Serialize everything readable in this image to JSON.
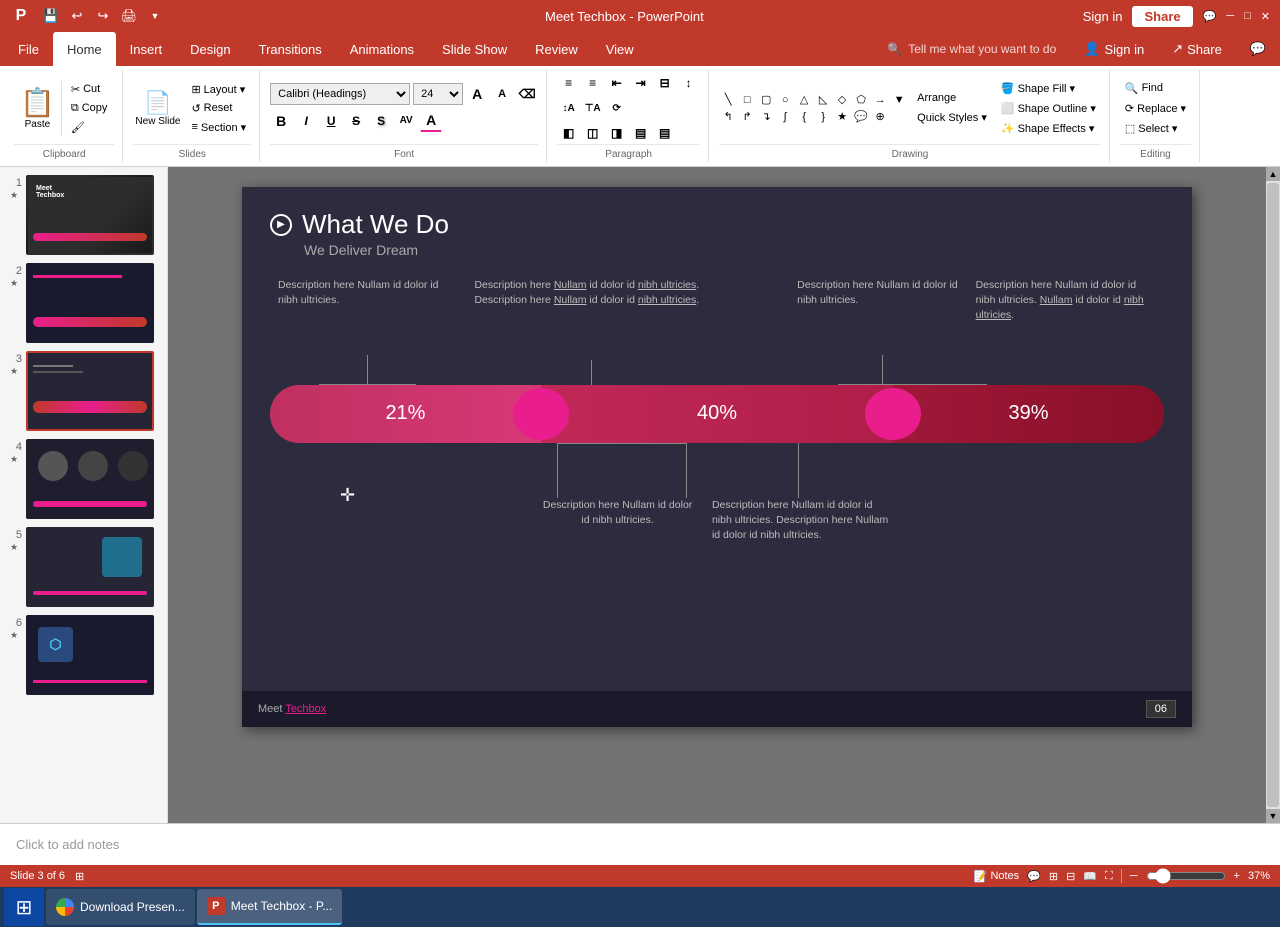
{
  "app": {
    "title": "Meet Techbox - PowerPoint",
    "sign_in": "Sign in",
    "share": "Share"
  },
  "titlebar": {
    "buttons": [
      "─",
      "□",
      "✕"
    ],
    "quickaccess": [
      "💾",
      "↩",
      "↪",
      "🖨",
      "▼"
    ]
  },
  "ribbon": {
    "tabs": [
      "File",
      "Home",
      "Insert",
      "Design",
      "Transitions",
      "Animations",
      "Slide Show",
      "Review",
      "View"
    ],
    "active_tab": "Home",
    "tell_me": "Tell me what you want to do",
    "groups": {
      "clipboard": {
        "label": "Clipboard",
        "paste": "Paste",
        "cut": "Cut",
        "copy": "Copy",
        "format_painter": "Format Painter"
      },
      "slides": {
        "label": "Slides",
        "new_slide": "New Slide",
        "layout": "Layout",
        "reset": "Reset",
        "section": "Section"
      },
      "font": {
        "label": "Font",
        "font_name": "Calibri (Headings)",
        "font_size": "24",
        "grow": "A",
        "shrink": "A",
        "clear": "Clear Formatting",
        "bold": "B",
        "italic": "I",
        "underline": "U",
        "strikethrough": "S",
        "shadow": "S",
        "char_spacing": "AV",
        "color": "A"
      },
      "paragraph": {
        "label": "Paragraph",
        "bullets": "≡",
        "numbering": "≡",
        "decrease_indent": "⇤",
        "increase_indent": "⇥",
        "text_direction": "Text Direction",
        "align_text": "Align Text",
        "smartart": "Convert to SmartArt"
      },
      "drawing": {
        "label": "Drawing",
        "shapes": "Shapes",
        "arrange": "Arrange",
        "quick_styles": "Quick Styles",
        "shape_fill": "Shape Fill",
        "shape_outline": "Shape Outline",
        "shape_effects": "Shape Effects"
      },
      "editing": {
        "label": "Editing",
        "find": "Find",
        "replace": "Replace",
        "select": "Select"
      }
    }
  },
  "slide_panel": {
    "slides": [
      {
        "num": "1",
        "label": "Slide 1",
        "has_star": true
      },
      {
        "num": "2",
        "label": "Slide 2",
        "has_star": true
      },
      {
        "num": "3",
        "label": "Slide 3",
        "has_star": true,
        "active": true
      },
      {
        "num": "4",
        "label": "Slide 4",
        "has_star": true
      },
      {
        "num": "5",
        "label": "Slide 5",
        "has_star": true
      },
      {
        "num": "6",
        "label": "Slide 6",
        "has_star": true
      }
    ]
  },
  "slide": {
    "title": "What We Do",
    "play_icon": "▶",
    "subtitle": "We Deliver Dream",
    "chart": {
      "segments": [
        {
          "label": "21%",
          "flex": 1
        },
        {
          "label": "40%",
          "flex": 1.4
        },
        {
          "label": "39%",
          "flex": 1
        }
      ],
      "top_descriptions": [
        {
          "text": "Description here Nullam id dolor id nibh ultricies.",
          "col": 1
        },
        {
          "text": "Description here Nullam id dolor id nibh ultricies. Description here Nullam id dolor id nibh ultricies.",
          "col": 2
        },
        {
          "text": "",
          "col": 3
        },
        {
          "text": "Description here Nullam id dolor id nibh ultricies.",
          "col": 4
        },
        {
          "text": "Description here Nullam id dolor id nibh ultricies. Nullam id dolor id nibh ultricies.",
          "col": 5
        }
      ],
      "bottom_descriptions": [
        {
          "text": "Description here Nullam id dolor id nibh ultricies.",
          "col": 1
        },
        {
          "text": "Description here Nullam id dolor id nibh ultricies. Description here Nullam id dolor id nibh ultricies.",
          "col": 2
        }
      ]
    },
    "footer_text": "Meet Techbox",
    "footer_brand": "Techbox",
    "footer_num": "06"
  },
  "notes": {
    "placeholder": "Click to add notes"
  },
  "status_bar": {
    "slide_info": "Slide 3 of 6",
    "zoom": "37%",
    "view_notes": "Notes",
    "fit_icon": "⊞"
  },
  "taskbar": {
    "start_icon": "⊞",
    "items": [
      {
        "label": "Download Presen...",
        "icon": "🌐",
        "active": false
      },
      {
        "label": "Meet Techbox - P...",
        "icon": "P",
        "active": true
      }
    ]
  }
}
